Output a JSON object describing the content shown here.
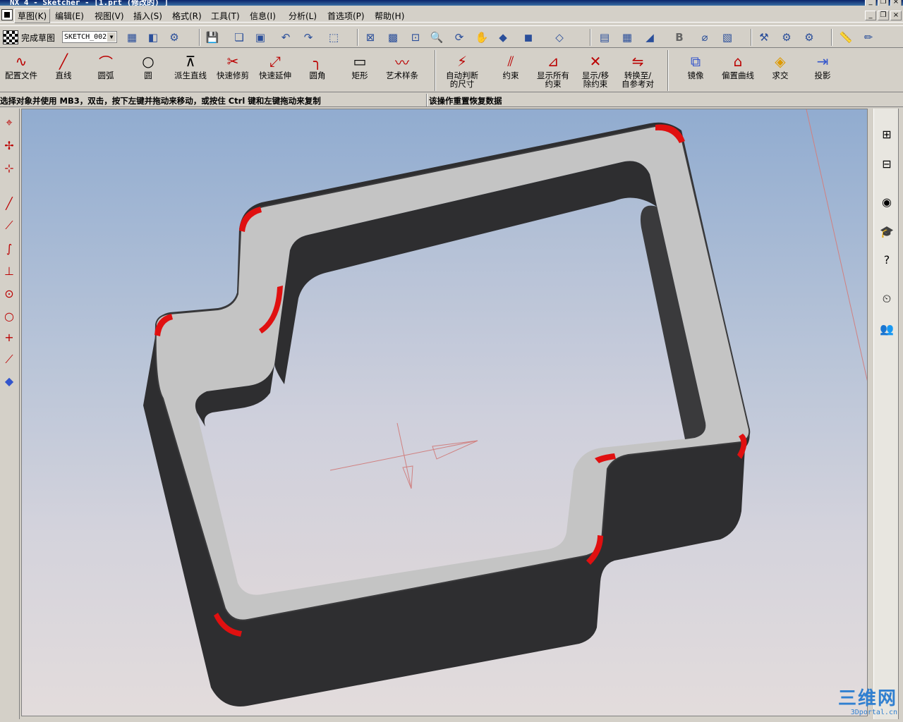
{
  "window": {
    "title": "NX 4 - Sketcher - [1.prt (修改的) ]"
  },
  "menubar": {
    "items": [
      "草图(K)",
      "编辑(E)",
      "视图(V)",
      "插入(S)",
      "格式(R)",
      "工具(T)",
      "信息(I)",
      "分析(L)",
      "首选项(P)",
      "帮助(H)"
    ]
  },
  "toolbar1": {
    "finish_label": "完成草图",
    "sketch_name": "SKETCH_002"
  },
  "toolbar2": {
    "tools": [
      {
        "label": "配置文件",
        "icon": "profile-icon"
      },
      {
        "label": "直线",
        "icon": "line-icon"
      },
      {
        "label": "圆弧",
        "icon": "arc-icon"
      },
      {
        "label": "圆",
        "icon": "circle-icon"
      },
      {
        "label": "派生直线",
        "icon": "derived-line-icon"
      },
      {
        "label": "快速修剪",
        "icon": "quick-trim-icon"
      },
      {
        "label": "快速延伸",
        "icon": "quick-extend-icon"
      },
      {
        "label": "圆角",
        "icon": "fillet-icon"
      },
      {
        "label": "矩形",
        "icon": "rectangle-icon"
      },
      {
        "label": "艺术样条",
        "icon": "studio-spline-icon"
      }
    ],
    "constraint_tools": [
      {
        "line1": "自动判断",
        "line2": "的尺寸",
        "icon": "inferred-dimension-icon"
      },
      {
        "line1": "约束",
        "line2": "",
        "icon": "constraints-icon"
      },
      {
        "line1": "显示所有",
        "line2": "约束",
        "icon": "show-all-constraints-icon"
      },
      {
        "line1": "显示/移",
        "line2": "除约束",
        "icon": "show-remove-constraints-icon"
      },
      {
        "line1": "转换至/",
        "line2": "自参考对",
        "icon": "convert-reference-icon"
      }
    ],
    "ops_tools": [
      {
        "label": "镜像",
        "icon": "mirror-icon"
      },
      {
        "label": "偏置曲线",
        "icon": "offset-curve-icon"
      },
      {
        "label": "求交",
        "icon": "intersect-icon"
      },
      {
        "label": "投影",
        "icon": "project-icon"
      }
    ]
  },
  "status": {
    "prompt": "选择对象并使用 MB3，双击，按下左键并拖动来移动，或按住 Ctrl 键和左键拖动来复制",
    "message": "该操作重置恢复数据"
  },
  "watermark": {
    "main": "三维网",
    "sub": "3Dportal.cn"
  },
  "colors": {
    "selection_red": "#e01010",
    "part_dark": "#2e2e30",
    "part_face": "#c4c4c4"
  }
}
